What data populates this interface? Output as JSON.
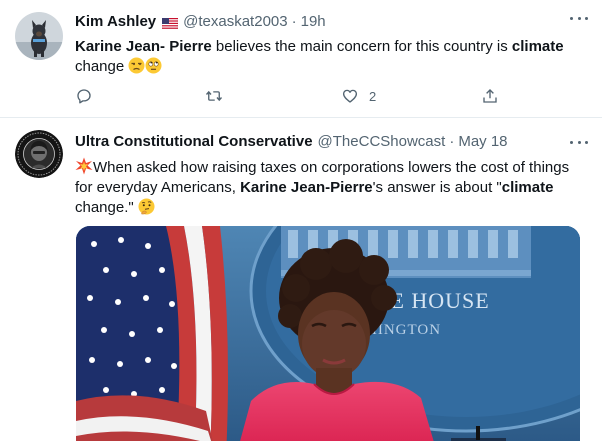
{
  "tweets": [
    {
      "name": "Kim Ashley",
      "flag": "🇺🇸",
      "handle": "@texaskat2003",
      "sep": "·",
      "time": "19h",
      "text": {
        "bold1": "Karine Jean- Pierre",
        "plain1": " believes the main concern for this country is ",
        "bold2": "climate",
        "plain2": " change "
      },
      "emojis": [
        "😒",
        "🙄"
      ],
      "actions": {
        "reply": "",
        "retweet": "",
        "like": "2",
        "share": ""
      }
    },
    {
      "name": "Ultra Constitutional Conservative",
      "handle": "@TheCCShowcast",
      "sep": "·",
      "time": "May 18",
      "text": {
        "plain1": "When asked how raising taxes on corporations lowers the cost of things for everyday Americans, ",
        "bold1": "Karine Jean-Pierre",
        "plain2": "'s answer is about \"",
        "bold2": "climate",
        "plain3": " change.\" "
      },
      "emojis": [
        "💥",
        "🤔"
      ],
      "media": {
        "sign_line1": "TE HOUSE",
        "sign_line2": "HINGTON"
      }
    }
  ],
  "colors": {
    "text": "#0f1419",
    "secondary": "#536471",
    "divider": "#e6ecf0",
    "media_bg": "#2d5d8e",
    "dress": "#e8315e"
  },
  "icons": [
    "more-icon",
    "reply-icon",
    "retweet-icon",
    "like-icon",
    "share-icon",
    "us-flag-icon"
  ]
}
